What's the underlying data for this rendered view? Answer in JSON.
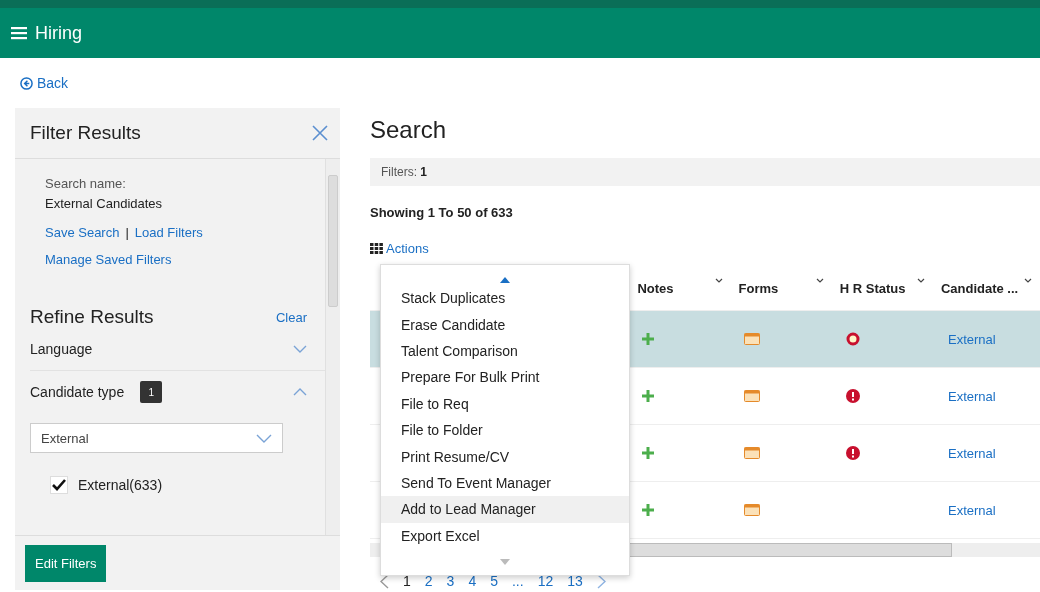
{
  "header": {
    "title": "Hiring"
  },
  "back": "Back",
  "filter_panel": {
    "title": "Filter Results",
    "search_name_label": "Search name:",
    "search_name": "External Candidates",
    "links": [
      "Save Search",
      "Load Filters"
    ],
    "separator": "|",
    "manage_link": "Manage Saved Filters",
    "refine_title": "Refine Results",
    "clear": "Clear",
    "sections": [
      {
        "label": "Language",
        "expanded": false
      },
      {
        "label": "Candidate type",
        "badge": "1",
        "expanded": true,
        "dropdown": "External",
        "options": [
          {
            "label": "External(633)",
            "checked": true
          }
        ]
      }
    ],
    "edit_button": "Edit Filters"
  },
  "main": {
    "title": "Search",
    "filters_label": "Filters:",
    "filters_count": "1",
    "showing": "Showing 1 To 50 of 633",
    "actions": "Actions",
    "columns": [
      "Notes",
      "Forms",
      "H R Status",
      "Candidate ..."
    ],
    "rows": [
      {
        "selected": true,
        "hr_status": {
          "kind": "ring"
        },
        "type": "External"
      },
      {
        "selected": false,
        "hr_status": {
          "kind": "alert"
        },
        "type": "External"
      },
      {
        "selected": false,
        "hr_status": {
          "kind": "alert"
        },
        "type": "External"
      },
      {
        "selected": false,
        "type": "External"
      }
    ],
    "menu": [
      {
        "label": "Stack Duplicates",
        "highlighted": false
      },
      {
        "label": "Erase Candidate",
        "highlighted": false
      },
      {
        "label": "Talent Comparison",
        "highlighted": false
      },
      {
        "label": "Prepare For Bulk Print",
        "highlighted": false
      },
      {
        "label": "File to Req",
        "highlighted": false
      },
      {
        "label": "File to Folder",
        "highlighted": false
      },
      {
        "label": "Print Resume/CV",
        "highlighted": false
      },
      {
        "label": "Send To Event Manager",
        "highlighted": false
      },
      {
        "label": "Add to Lead Manager",
        "highlighted": true
      },
      {
        "label": "Export Excel",
        "highlighted": false
      }
    ],
    "pages": [
      {
        "label": "1",
        "selected": true
      },
      {
        "label": "2",
        "selected": false
      },
      {
        "label": "3",
        "selected": false
      },
      {
        "label": "4",
        "selected": false
      },
      {
        "label": "5",
        "selected": false
      },
      {
        "label": "...",
        "selected": false
      },
      {
        "label": "12",
        "selected": false
      },
      {
        "label": "13",
        "selected": false
      }
    ]
  }
}
